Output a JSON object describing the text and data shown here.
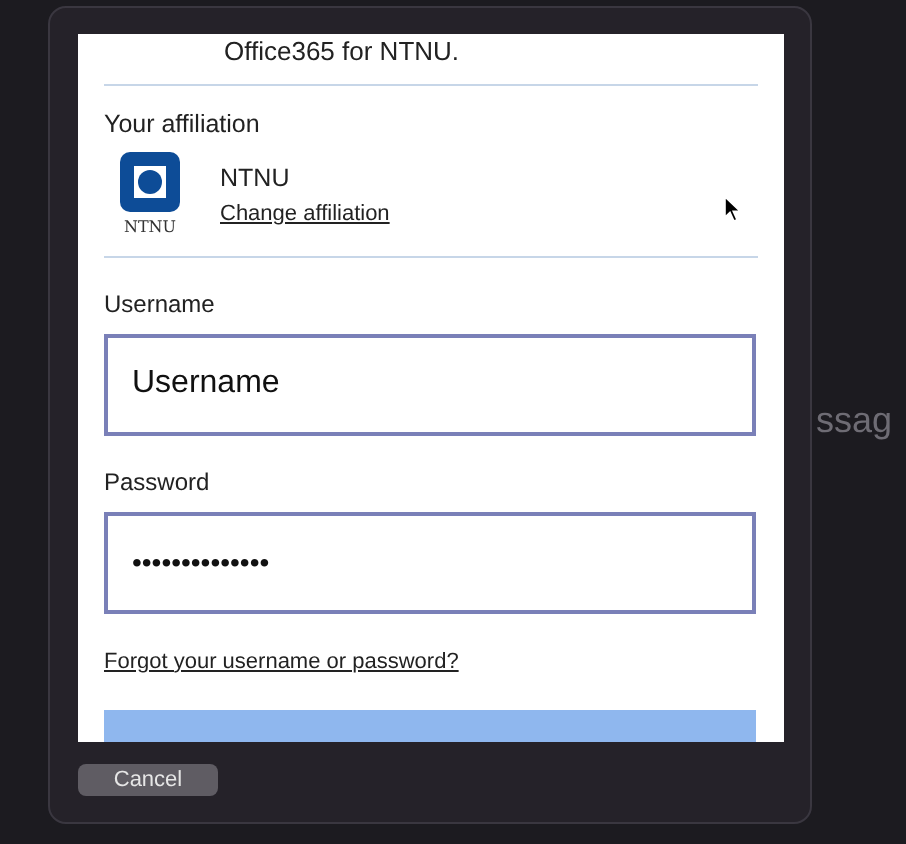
{
  "intro_text": "Office365 for NTNU.",
  "affiliation": {
    "heading": "Your affiliation",
    "logo_caption": "NTNU",
    "name": "NTNU",
    "change_link": "Change affiliation"
  },
  "username": {
    "label": "Username",
    "placeholder": "Username"
  },
  "password": {
    "label": "Password",
    "value": "••••••••••••••"
  },
  "forgot_link": "Forgot your username or password?",
  "cancel_button": "Cancel",
  "background_text": "ssag"
}
